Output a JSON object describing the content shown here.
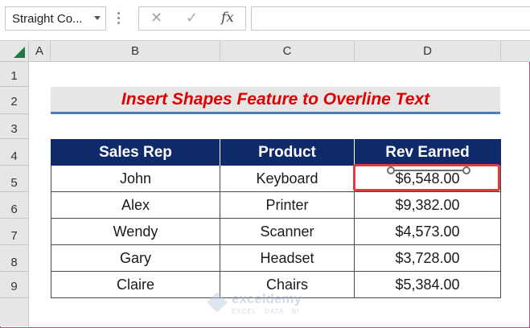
{
  "formula_bar": {
    "name_box": "Straight Co...",
    "cancel_icon": "✕",
    "enter_icon": "✓",
    "fx_icon": "fx",
    "formula": ""
  },
  "columns": [
    "A",
    "B",
    "C",
    "D"
  ],
  "rows": [
    "1",
    "2",
    "3",
    "4",
    "5",
    "6",
    "7",
    "8",
    "9"
  ],
  "title": "Insert Shapes Feature to Overline Text",
  "table": {
    "headers": [
      "Sales Rep",
      "Product",
      "Rev Earned"
    ],
    "rows": [
      [
        "John",
        "Keyboard",
        "$6,548.00"
      ],
      [
        "Alex",
        "Printer",
        "$9,382.00"
      ],
      [
        "Wendy",
        "Scanner",
        "$4,573.00"
      ],
      [
        "Gary",
        "Headset",
        "$3,728.00"
      ],
      [
        "Claire",
        "Chairs",
        "$5,384.00"
      ]
    ]
  },
  "watermark": {
    "name": "exceldemy",
    "tagline": "EXCEL · DATA · BI"
  },
  "colors": {
    "title_text": "#e00000",
    "header_bg": "#0e2a6b",
    "highlight": "#e23b3b",
    "accent_line": "#4a7ec4"
  }
}
